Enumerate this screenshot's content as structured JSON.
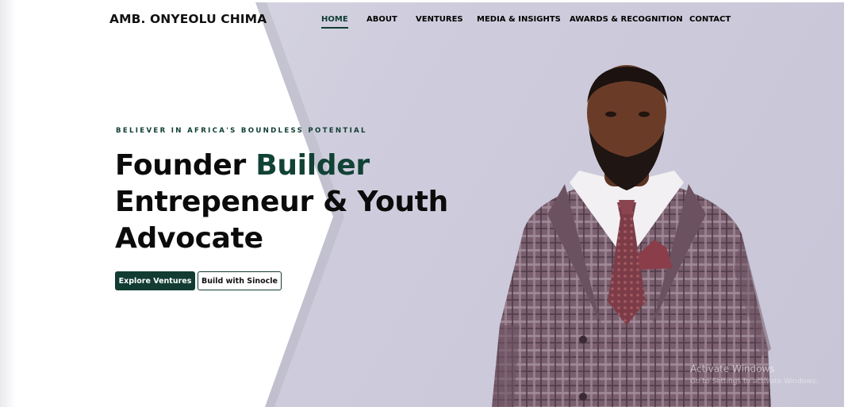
{
  "brand": {
    "name": "AMB. ONYEOLU CHIMA"
  },
  "nav": {
    "items": [
      {
        "label": "HOME",
        "active": true
      },
      {
        "label": "ABOUT",
        "active": false
      },
      {
        "label": "VENTURES",
        "active": false
      },
      {
        "label": "MEDIA & INSIGHTS",
        "active": false
      },
      {
        "label": "AWARDS & RECOGNITION",
        "active": false
      },
      {
        "label": "CONTACT",
        "active": false
      }
    ]
  },
  "hero": {
    "eyebrow": "BELIEVER IN AFRICA'S BOUNDLESS POTENTIAL",
    "headline_line1_a": "Founder",
    "headline_line1_b": "Builder",
    "headline_line2": "Entrepeneur & Youth",
    "headline_line3": "Advocate",
    "primary_button": "Explore Ventures",
    "secondary_button": "Build with Sinocle"
  },
  "watermark": {
    "line1": "Activate Windows",
    "line2": "Go to Settings to activate Windows."
  },
  "colors": {
    "accent": "#123c31",
    "panel": "#cfcddd",
    "text": "#0b0b0b"
  }
}
